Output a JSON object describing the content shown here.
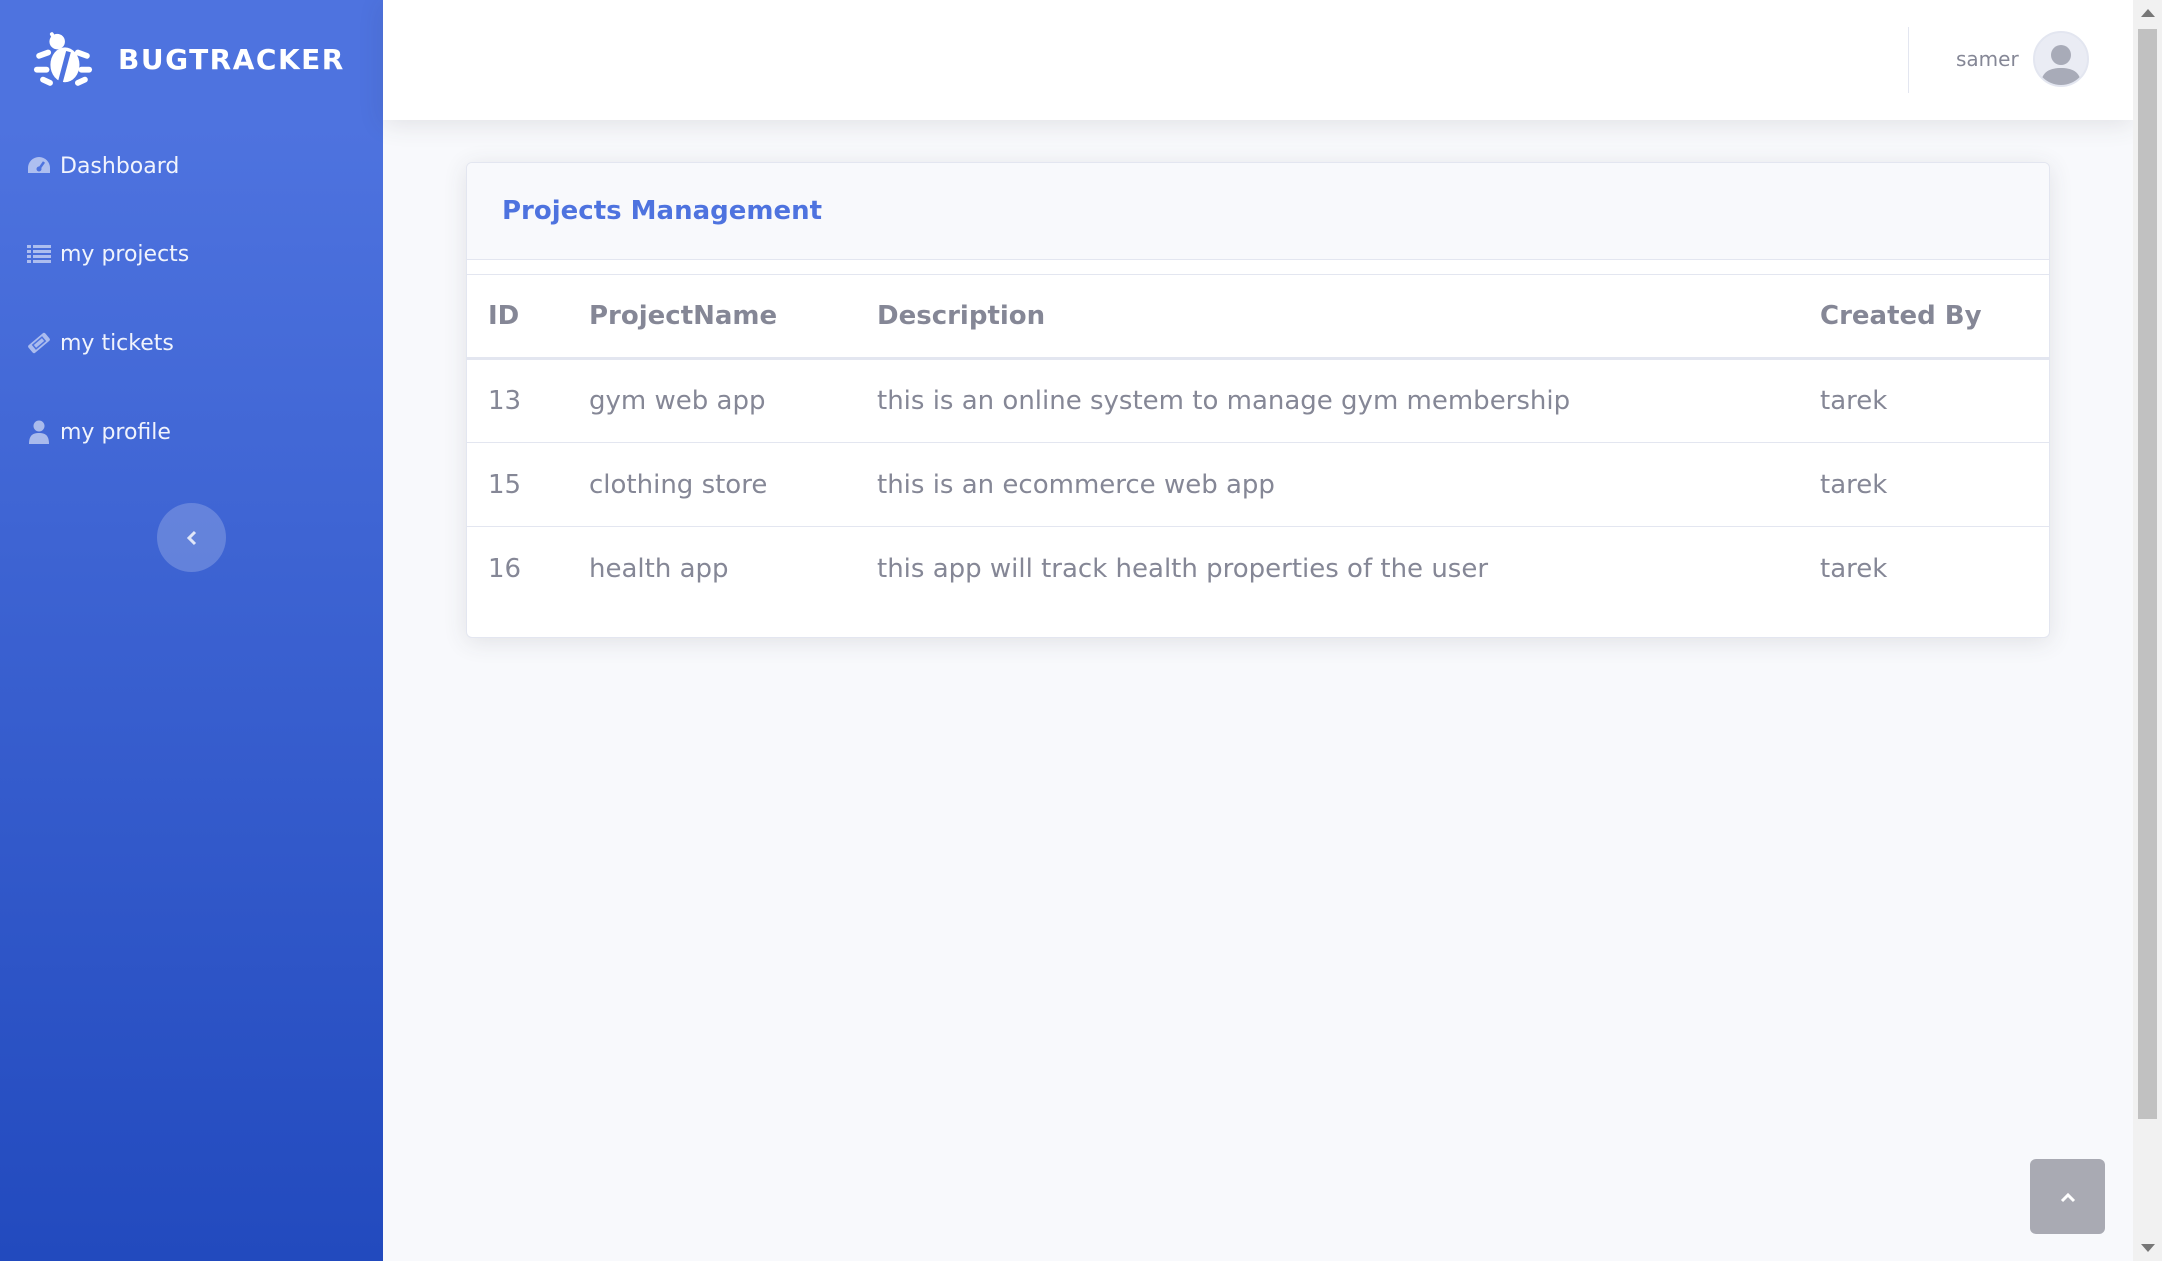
{
  "brand": {
    "name": "BUGTRACKER",
    "icon": "bug-icon"
  },
  "sidebar": {
    "items": [
      {
        "label": "Dashboard",
        "icon": "tachometer-icon"
      },
      {
        "label": "my projects",
        "icon": "list-icon"
      },
      {
        "label": "my tickets",
        "icon": "ticket-icon"
      },
      {
        "label": "my profile",
        "icon": "user-icon"
      }
    ],
    "toggle_icon": "chevron-left-icon"
  },
  "topbar": {
    "username": "samer",
    "avatar_icon": "user-avatar-icon"
  },
  "card": {
    "title": "Projects Management",
    "columns": [
      "ID",
      "ProjectName",
      "Description",
      "Created By"
    ],
    "rows": [
      [
        "13",
        "gym web app",
        "this is an online system to manage gym membership",
        "tarek"
      ],
      [
        "15",
        "clothing store",
        "this is an ecommerce web app",
        "tarek"
      ],
      [
        "16",
        "health app",
        "this app will track health properties of the user",
        "tarek"
      ]
    ]
  },
  "colors": {
    "sidebar_start": "#4e73df",
    "sidebar_end": "#224abe",
    "accent": "#4e73df",
    "text_muted": "#858796",
    "background": "#f8f9fc"
  },
  "scroll_top_icon": "chevron-up-icon"
}
